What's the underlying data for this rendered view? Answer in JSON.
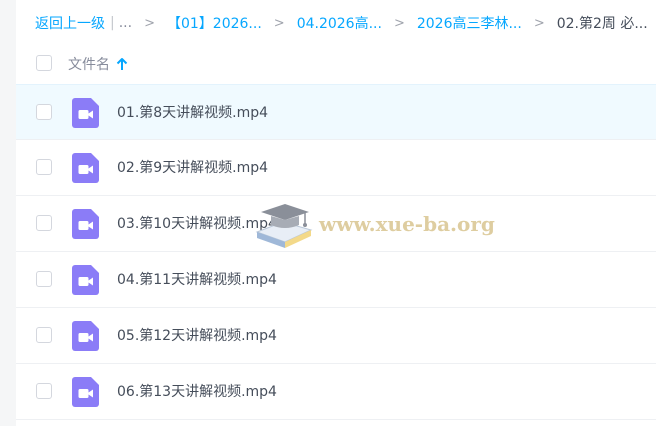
{
  "breadcrumb": {
    "back_label": "返回上一级",
    "ellipsis": "...",
    "separator": ">",
    "crumbs": [
      "【01】2026...",
      "04.2026高...",
      "2026高三李林..."
    ],
    "current": "02.第2周 必..."
  },
  "header": {
    "column_label": "文件名"
  },
  "files": [
    {
      "name": "01.第8天讲解视频.mp4",
      "selected": true
    },
    {
      "name": "02.第9天讲解视频.mp4"
    },
    {
      "name": "03.第10天讲解视频.mp4"
    },
    {
      "name": "04.第11天讲解视频.mp4"
    },
    {
      "name": "05.第12天讲解视频.mp4"
    },
    {
      "name": "06.第13天讲解视频.mp4"
    }
  ],
  "watermark": {
    "text": "www.xue-ba.org"
  },
  "colors": {
    "accent": "#06a7ff",
    "video_icon": "#8b7cf7",
    "selected_row": "#f0faff"
  }
}
